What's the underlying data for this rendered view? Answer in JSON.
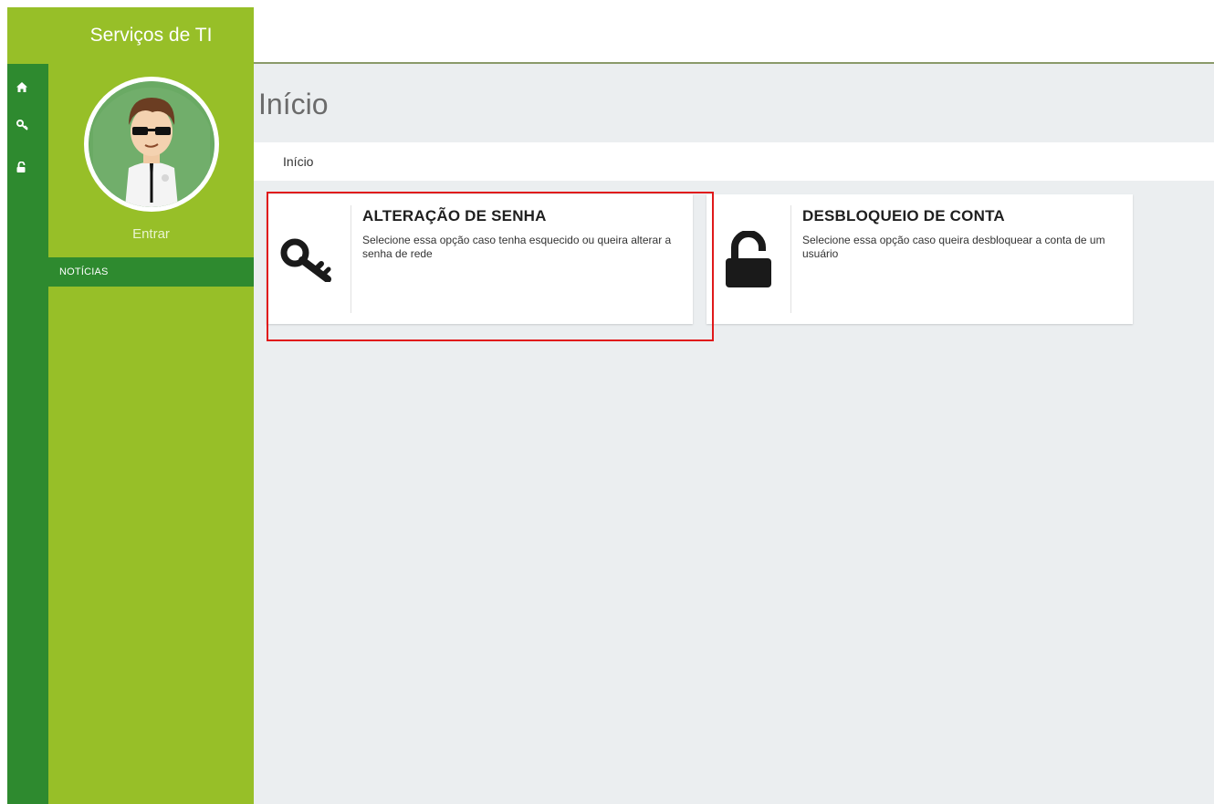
{
  "sidebar": {
    "brand": "Serviços de TI",
    "login_label": "Entrar",
    "news_label": "NOTÍCIAS",
    "rail_icons": [
      "home-icon",
      "key-icon",
      "unlock-icon"
    ]
  },
  "main": {
    "page_title": "Início",
    "breadcrumb": "Início",
    "cards": [
      {
        "title": "ALTERAÇÃO DE SENHA",
        "description": "Selecione essa opção caso tenha esquecido ou queira alterar a senha de rede",
        "icon": "key-icon"
      },
      {
        "title": "DESBLOQUEIO DE CONTA",
        "description": "Selecione essa opção caso queira desbloquear a conta de um usuário",
        "icon": "unlock-icon"
      }
    ]
  },
  "colors": {
    "sidebar_green": "#97bf28",
    "rail_dark_green": "#2e8a2f",
    "content_bg": "#ebeef0",
    "highlight_red": "#e0191b"
  }
}
